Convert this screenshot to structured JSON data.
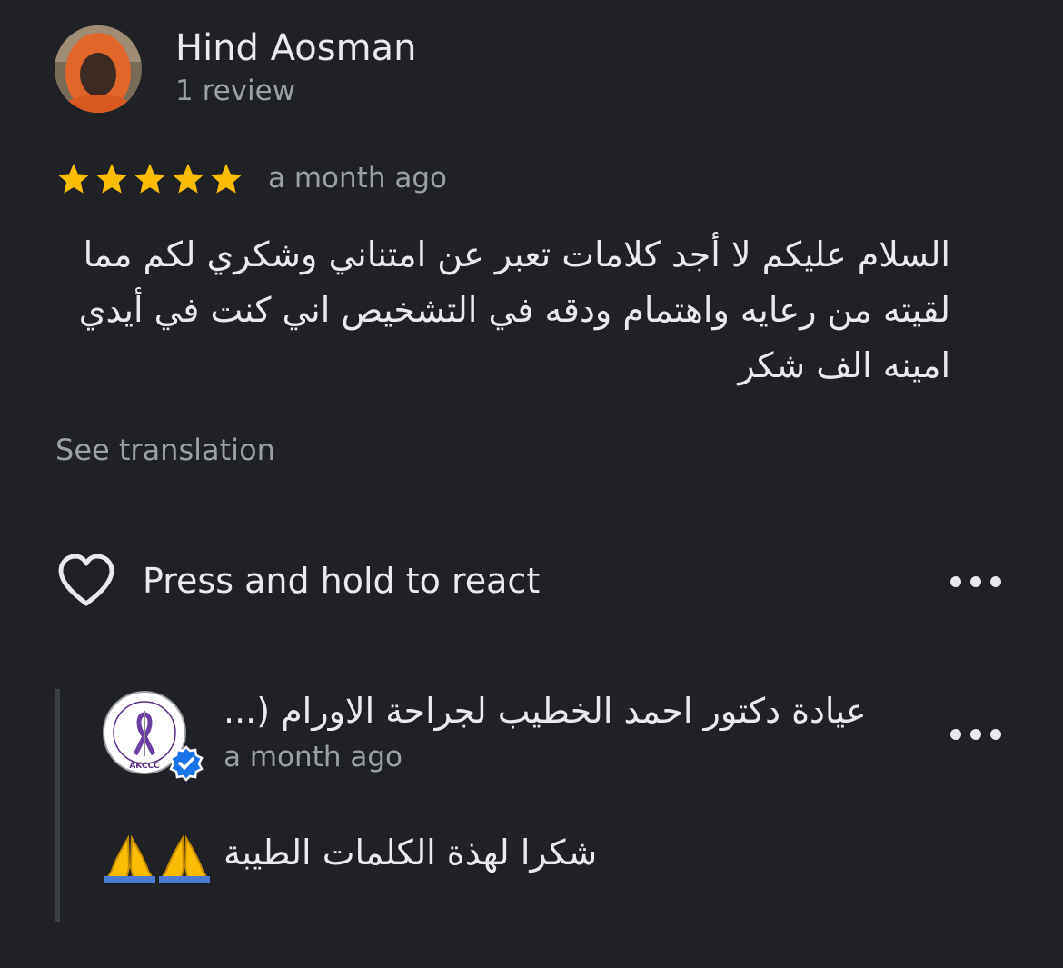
{
  "reviewer": {
    "name": "Hind Aosman",
    "review_count": "1 review"
  },
  "review": {
    "rating": 5,
    "rating_max": 5,
    "time": "a month ago",
    "text": "السلام عليكم  لا أجد كلامات تعبر عن امتناني وشكري لكم مما لقيته من رعايه واهتمام ودقه  في التشخيص اني كنت في أيدي امينه الف شكر",
    "see_translation": "See translation",
    "react_label": "Press and hold to react"
  },
  "owner_reply": {
    "name": "عيادة دكتور احمد الخطيب لجراحة الاورام (...",
    "logo_text": "AKCCC",
    "time": "a month ago",
    "text": "شكرا لهذة الكلمات الطيبة",
    "emoji": "🙏🙏"
  },
  "colors": {
    "background": "#202124",
    "star": "#fbbc04",
    "primary_text": "#e8eaed",
    "secondary_text": "#9aa0a6",
    "verified": "#1a73e8"
  },
  "icons": [
    "star-icon",
    "heart-outline-icon",
    "more-horizontal-icon",
    "verified-badge-icon",
    "praying-hands-icon"
  ]
}
